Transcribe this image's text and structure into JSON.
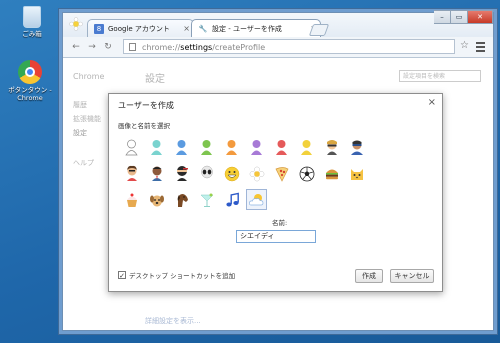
{
  "desktop": {
    "recycle_bin": "ごみ箱",
    "chrome_shortcut": "ポタンタウン - Chrome"
  },
  "browser": {
    "tabs": [
      {
        "label": "Google アカウント",
        "icon": "google-favicon"
      },
      {
        "label": "設定 - ユーザーを作成",
        "icon": "wrench-icon"
      }
    ],
    "url": "chrome://settings/createProfile",
    "url_parts": {
      "scheme": "chrome://",
      "host": "settings",
      "path": "/createProfile"
    }
  },
  "settings_bg": {
    "brand": "Chrome",
    "title": "設定",
    "search_placeholder": "設定項目を検索",
    "side_items": [
      "履歴",
      "拡張機能",
      "設定"
    ],
    "help": "ヘルプ",
    "advanced_link": "詳細設定を表示..."
  },
  "dialog": {
    "title": "ユーザーを作成",
    "subtitle": "画像と名前を選択",
    "name_label": "名前:",
    "name_value": "シエイディ",
    "shortcut_label": "デスクトップ ショートカットを追加",
    "shortcut_checked": true,
    "create_label": "作成",
    "cancel_label": "キャンセル",
    "avatars": [
      [
        "avatar-white",
        "avatar-teal",
        "avatar-blue",
        "avatar-green",
        "avatar-orange",
        "avatar-purple",
        "avatar-red",
        "avatar-yellow",
        "avatar-secret-agent",
        "avatar-superhero"
      ],
      [
        "avatar-volleyball",
        "avatar-businessman",
        "avatar-ninja",
        "avatar-alien",
        "avatar-awesome",
        "avatar-flower",
        "avatar-pizza",
        "avatar-soccer",
        "avatar-burger",
        "avatar-cat"
      ],
      [
        "avatar-cupcake",
        "avatar-dog",
        "avatar-horse",
        "avatar-margarita",
        "avatar-note",
        "avatar-sun-cloud"
      ]
    ],
    "selected_avatar": "avatar-sun-cloud"
  }
}
